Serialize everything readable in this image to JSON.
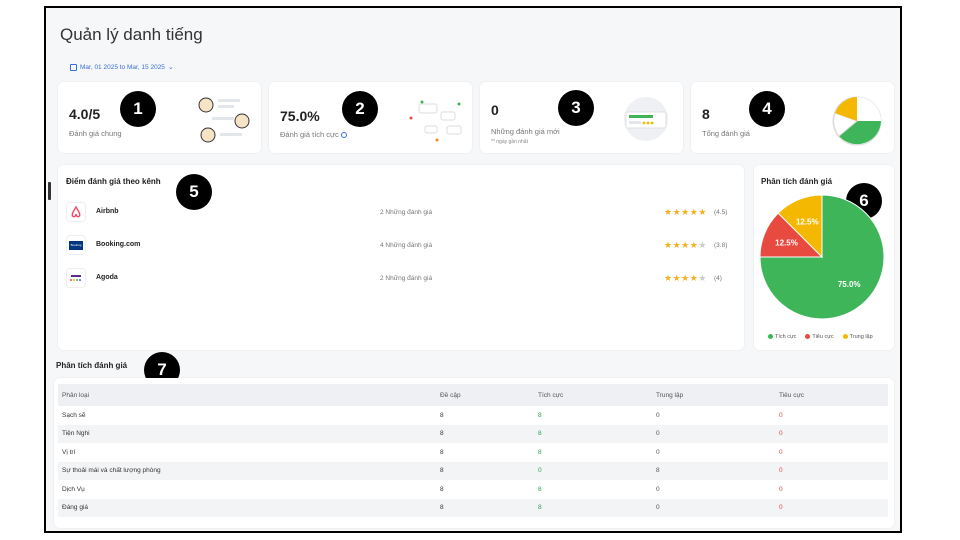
{
  "header": {
    "title": "Quản lý danh tiếng",
    "date_range": "Mar, 01 2025 to Mar, 15 2025"
  },
  "kpis": [
    {
      "value": "4.0/5",
      "label": "Đánh giá chung",
      "badge": "1"
    },
    {
      "value": "75.0%",
      "label": "Đánh giá tích cực",
      "badge": "2"
    },
    {
      "value": "0",
      "label": "Những đánh giá mới",
      "sub": "** ngày gần nhất",
      "badge": "3"
    },
    {
      "value": "8",
      "label": "Tổng đánh giá",
      "badge": "4"
    }
  ],
  "channels": {
    "title": "Điểm đánh giá theo kênh",
    "badge": "5",
    "items": [
      {
        "name": "Airbnb",
        "count": "2 Những đánh giá",
        "stars": 4.5,
        "rating": "(4.5)",
        "logo_color": "#ff385c"
      },
      {
        "name": "Booking.com",
        "count": "4 Những đánh giá",
        "stars": 3.5,
        "rating": "(3.8)",
        "logo_color": "#003580"
      },
      {
        "name": "Agoda",
        "count": "2 Những đánh giá",
        "stars": 4,
        "rating": "(4)",
        "logo_color": "#5a2d82"
      }
    ]
  },
  "sentiment": {
    "title": "Phân tích đánh giá",
    "badge": "6",
    "legend": [
      {
        "label": "Tích cực",
        "color": "#3fb55a"
      },
      {
        "label": "Tiêu cực",
        "color": "#e84a3f"
      },
      {
        "label": "Trung lập",
        "color": "#f5b800"
      }
    ]
  },
  "chart_data": {
    "type": "pie",
    "slices": [
      {
        "label": "Tích cực",
        "value": 75.0,
        "text": "75.0%",
        "color": "#3fb55a"
      },
      {
        "label": "Tiêu cực",
        "value": 12.5,
        "text": "12.5%",
        "color": "#e84a3f"
      },
      {
        "label": "Trung lập",
        "value": 12.5,
        "text": "12.5%",
        "color": "#f5b800"
      }
    ]
  },
  "analysis": {
    "title": "Phân tích đánh giá",
    "badge": "7",
    "columns": [
      "Phân loại",
      "Đề cập",
      "Tích cực",
      "Trung lập",
      "Tiêu cực"
    ],
    "rows": [
      {
        "category": "Sạch sẽ",
        "mentions": "8",
        "positive": "8",
        "neutral": "0",
        "negative": "0"
      },
      {
        "category": "Tiện Nghi",
        "mentions": "8",
        "positive": "8",
        "neutral": "0",
        "negative": "0"
      },
      {
        "category": "Vị trí",
        "mentions": "8",
        "positive": "8",
        "neutral": "0",
        "negative": "0"
      },
      {
        "category": "Sự thoải mái và chất lượng phòng",
        "mentions": "8",
        "positive": "0",
        "neutral": "8",
        "negative": "0"
      },
      {
        "category": "Dịch Vụ",
        "mentions": "8",
        "positive": "8",
        "neutral": "0",
        "negative": "0"
      },
      {
        "category": "Đáng giá",
        "mentions": "8",
        "positive": "8",
        "neutral": "0",
        "negative": "0"
      }
    ]
  }
}
